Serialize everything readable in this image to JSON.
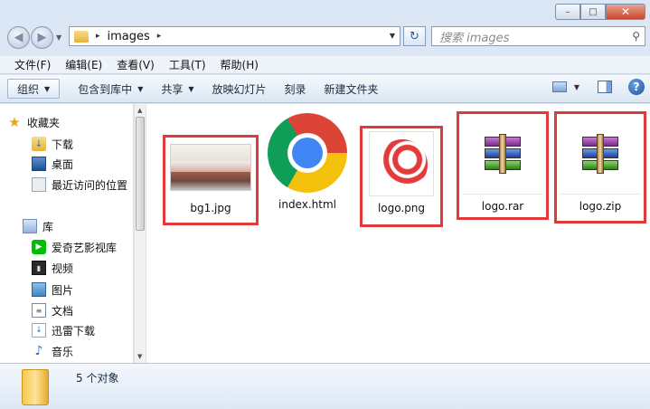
{
  "window": {
    "controls": [
      "–",
      "□",
      "✕"
    ]
  },
  "address": {
    "path": "images",
    "sep": "▸",
    "back": "◀",
    "forward": "▶"
  },
  "search": {
    "placeholder": "搜索 images"
  },
  "menu": [
    "文件(F)",
    "编辑(E)",
    "查看(V)",
    "工具(T)",
    "帮助(H)"
  ],
  "toolbar": {
    "organize": "组织",
    "include_in_library": "包含到库中",
    "share": "共享",
    "slideshow": "放映幻灯片",
    "burn": "刻录",
    "new_folder": "新建文件夹",
    "help": "?"
  },
  "sidebar": {
    "favorites": {
      "label": "收藏夹",
      "items": [
        "下载",
        "桌面",
        "最近访问的位置"
      ]
    },
    "libraries": {
      "label": "库",
      "items": [
        "爱奇艺影视库",
        "视频",
        "图片",
        "文档",
        "迅雷下载",
        "音乐"
      ]
    }
  },
  "files": [
    {
      "name": "bg1.jpg",
      "kind": "image-thumbnail",
      "highlighted": true
    },
    {
      "name": "index.html",
      "kind": "chrome-document",
      "highlighted": false
    },
    {
      "name": "logo.png",
      "kind": "image-thumbnail",
      "highlighted": true
    },
    {
      "name": "logo.rar",
      "kind": "archive",
      "highlighted": true
    },
    {
      "name": "logo.zip",
      "kind": "archive",
      "highlighted": true
    }
  ],
  "details": {
    "count": "5 个对象"
  },
  "colors": {
    "highlight": "#e03a3a",
    "accent": "#2b6cc4",
    "background": "#dbe7f4"
  }
}
